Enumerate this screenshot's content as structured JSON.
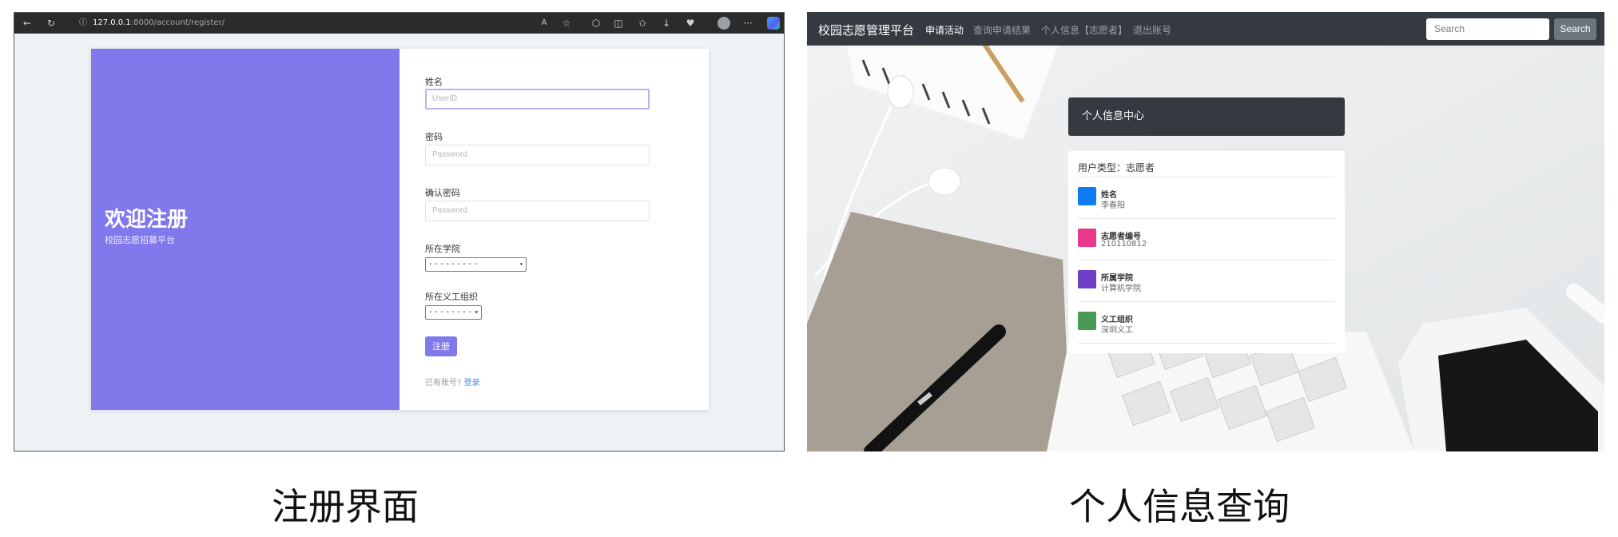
{
  "register_panel": {
    "url_host": "127.0.0.1",
    "url_rest": ":8000/account/register/",
    "hero_title": "欢迎注册",
    "hero_subtitle": "校园志愿招募平台",
    "fields": [
      {
        "label": "姓名",
        "placeholder": "UserID"
      },
      {
        "label": "密码",
        "placeholder": "Password"
      },
      {
        "label": "确认密码",
        "placeholder": "Password"
      }
    ],
    "college_label": "所在学院",
    "college_value": "---------",
    "org_label": "所在义工组织",
    "org_value": "---------",
    "register_button": "注册",
    "login_hint": "已有账号?",
    "login_link": "登录",
    "accent_color": "#8178ec"
  },
  "profile_panel": {
    "brand": "校园志愿管理平台",
    "nav": [
      "申请活动",
      "查询申请结果",
      "个人信息【志愿者】",
      "退出账号"
    ],
    "search_placeholder": "Search",
    "search_button": "Search",
    "header_title": "个人信息中心",
    "user_type": "用户类型：志愿者",
    "rows": [
      {
        "title": "姓名",
        "value": "李春阳",
        "color": "#0d7cf2"
      },
      {
        "title": "志愿者编号",
        "value": "210110812",
        "color": "#e8388a"
      },
      {
        "title": "所属学院",
        "value": "计算机学院",
        "color": "#6b3fc6"
      },
      {
        "title": "义工组织",
        "value": "深圳义工",
        "color": "#4a9a53"
      }
    ]
  },
  "captions": {
    "left": "注册界面",
    "right": "个人信息查询"
  }
}
